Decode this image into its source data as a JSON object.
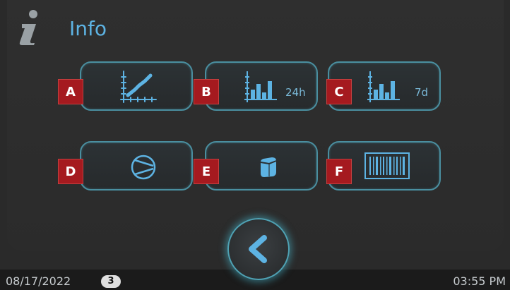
{
  "header": {
    "title": "Info",
    "icon": "info-icon"
  },
  "tiles": [
    {
      "badge": "A",
      "icon": "line-chart-icon",
      "label": ""
    },
    {
      "badge": "B",
      "icon": "bar-chart-icon",
      "label": "24h"
    },
    {
      "badge": "C",
      "icon": "bar-chart-icon",
      "label": "7d"
    },
    {
      "badge": "D",
      "icon": "compressor-icon",
      "label": ""
    },
    {
      "badge": "E",
      "icon": "ice-cube-icon",
      "label": ""
    },
    {
      "badge": "F",
      "icon": "barcode-icon",
      "label": ""
    }
  ],
  "back_button": {
    "icon": "chevron-left-icon"
  },
  "status": {
    "date": "08/17/2022",
    "count": "3",
    "time": "03:55 PM"
  },
  "colors": {
    "accent": "#5db3e3",
    "badge": "#a51a1f",
    "tile_border": "#4a8fa0",
    "glow": "#4fa2b4"
  }
}
